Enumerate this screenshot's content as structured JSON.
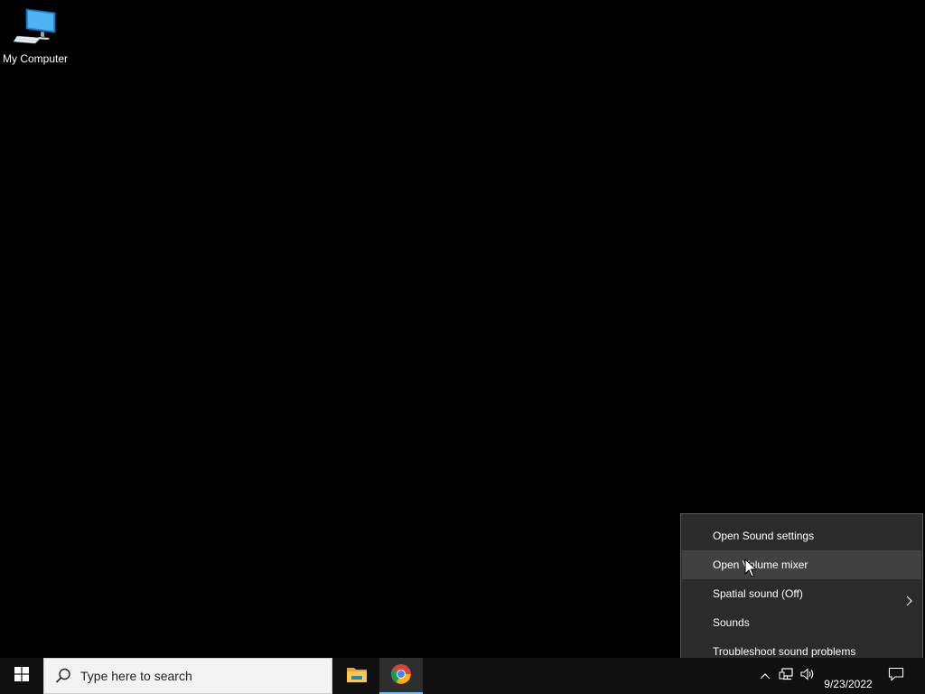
{
  "desktop": {
    "icons": [
      {
        "label": "My Computer",
        "icon": "my-computer-icon"
      }
    ]
  },
  "context_menu": {
    "items": [
      {
        "label": "Open Sound settings",
        "hovered": false,
        "has_submenu": false
      },
      {
        "label": "Open Volume mixer",
        "hovered": true,
        "has_submenu": false
      },
      {
        "label": "Spatial sound (Off)",
        "hovered": false,
        "has_submenu": true
      },
      {
        "label": "Sounds",
        "hovered": false,
        "has_submenu": false
      },
      {
        "label": "Troubleshoot sound problems",
        "hovered": false,
        "has_submenu": false
      }
    ]
  },
  "taskbar": {
    "start_icon": "windows-logo-icon",
    "search": {
      "placeholder": "Type here to search",
      "icon": "search-icon"
    },
    "pinned_apps": [
      {
        "name": "File Explorer",
        "icon": "file-explorer-icon",
        "active": false
      },
      {
        "name": "Google Chrome",
        "icon": "chrome-icon",
        "active": true
      }
    ],
    "tray": {
      "icons": [
        "chevron-up-icon",
        "network-icon",
        "volume-icon"
      ],
      "date": "9/23/2022",
      "notifications_icon": "notification-icon"
    }
  },
  "colors": {
    "desktop_bg": "#000000",
    "taskbar_bg": "#101010",
    "menu_bg": "#2b2b2b",
    "menu_hover": "#414141",
    "accent": "#76b9ed"
  }
}
